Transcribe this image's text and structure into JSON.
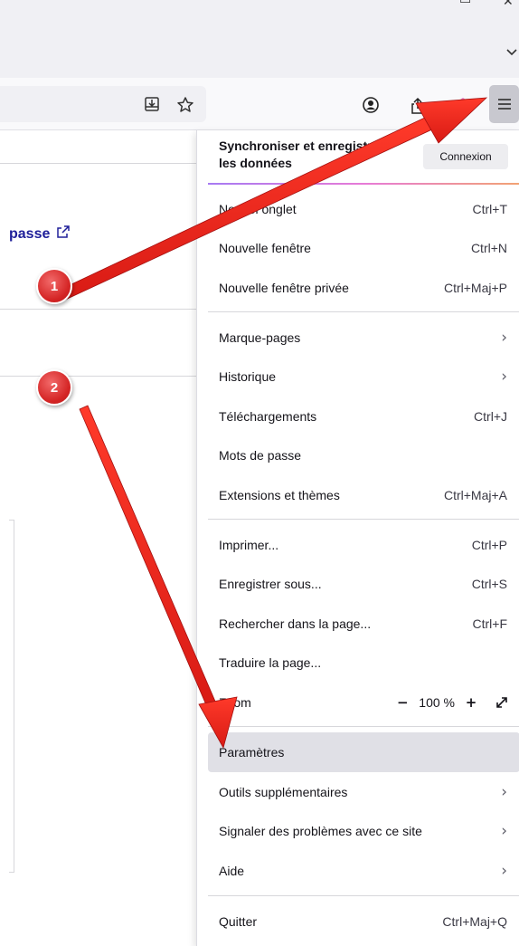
{
  "toolbar": {
    "window_controls": [
      "minimize-icon",
      "close-icon"
    ],
    "list_all_tabs_icon": "chevron-down-icon",
    "url_icons": [
      "save-to-pocket-icon",
      "bookmark-star-icon"
    ],
    "right_icons": [
      "account-icon",
      "share-icon",
      "extension-icon",
      "hamburger-menu-icon"
    ]
  },
  "page": {
    "passwords_link": "passe",
    "passwords_link_icon": "external-link-icon"
  },
  "menu": {
    "sync": {
      "title": "Synchroniser et enregistrer les données",
      "button": "Connexion"
    },
    "items": {
      "new_tab": {
        "label": "Nouvel onglet",
        "shortcut": "Ctrl+T"
      },
      "new_window": {
        "label": "Nouvelle fenêtre",
        "shortcut": "Ctrl+N"
      },
      "new_private": {
        "label": "Nouvelle fenêtre privée",
        "shortcut": "Ctrl+Maj+P"
      },
      "bookmarks": {
        "label": "Marque-pages"
      },
      "history": {
        "label": "Historique"
      },
      "downloads": {
        "label": "Téléchargements",
        "shortcut": "Ctrl+J"
      },
      "passwords": {
        "label": "Mots de passe"
      },
      "addons": {
        "label": "Extensions et thèmes",
        "shortcut": "Ctrl+Maj+A"
      },
      "print": {
        "label": "Imprimer...",
        "shortcut": "Ctrl+P"
      },
      "save_as": {
        "label": "Enregistrer sous...",
        "shortcut": "Ctrl+S"
      },
      "find": {
        "label": "Rechercher dans la page...",
        "shortcut": "Ctrl+F"
      },
      "translate": {
        "label": "Traduire la page..."
      },
      "zoom": {
        "label": "Zoom",
        "minus": "−",
        "value": "100 %",
        "plus": "+"
      },
      "settings": {
        "label": "Paramètres"
      },
      "more_tools": {
        "label": "Outils supplémentaires"
      },
      "report": {
        "label": "Signaler des problèmes avec ce site"
      },
      "help": {
        "label": "Aide"
      },
      "quit": {
        "label": "Quitter",
        "shortcut": "Ctrl+Maj+Q"
      }
    },
    "highlighted_item": "settings"
  },
  "annotations": {
    "badges": [
      "1",
      "2"
    ],
    "color": "#e8201f"
  },
  "colors": {
    "highlight": "#e0e0e6",
    "link": "#20209a",
    "accent_gradient": [
      "#a77bf3",
      "#e77bd7",
      "#f2a373"
    ]
  }
}
